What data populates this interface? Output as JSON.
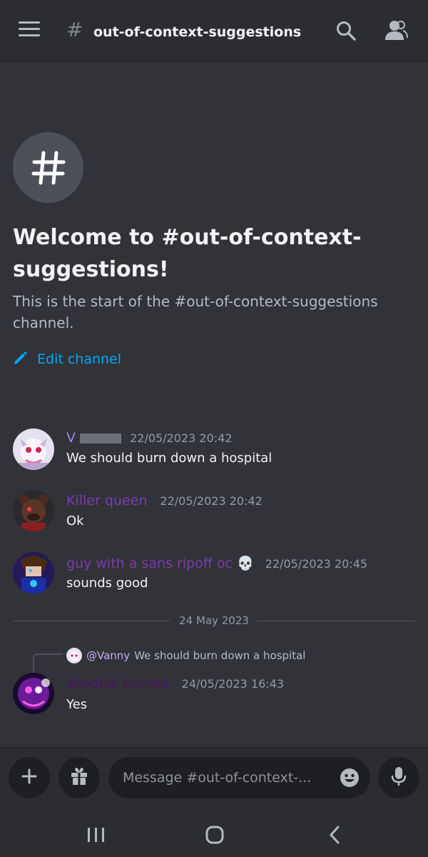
{
  "header": {
    "channel_name": "out-of-context-suggestions",
    "hash_symbol": "#"
  },
  "welcome": {
    "icon_symbol": "#",
    "title": "Welcome to #out-of-context-suggestions!",
    "description": "This is the start of the #out-of-context-suggestions channel.",
    "edit_label": "Edit channel"
  },
  "messages": [
    {
      "author": "V",
      "timestamp": "22/05/2023 20:42",
      "content": "We should burn down a hospital",
      "author_color": "#9b84ec"
    },
    {
      "author": "Killer queen",
      "timestamp": "22/05/2023 20:42",
      "content": "Ok",
      "author_color": "#7b3ab0"
    },
    {
      "author": "guy with a sans ripoff oc",
      "author_emoji": "💀",
      "timestamp": "22/05/2023 20:45",
      "content": "sounds good",
      "author_color": "#7b3ab0"
    },
    {
      "author": "shadow bonnie",
      "timestamp": "24/05/2023 16:43",
      "content": "Yes",
      "author_color": "#4a1463"
    }
  ],
  "date_divider": "24 May 2023",
  "reply": {
    "mention": "@Vanny",
    "text": "We should burn down a hospital"
  },
  "composer": {
    "placeholder": "Message #out-of-context-..."
  },
  "colors": {
    "background": "#313338",
    "header": "#2b2d31",
    "link": "#00a8fc"
  }
}
